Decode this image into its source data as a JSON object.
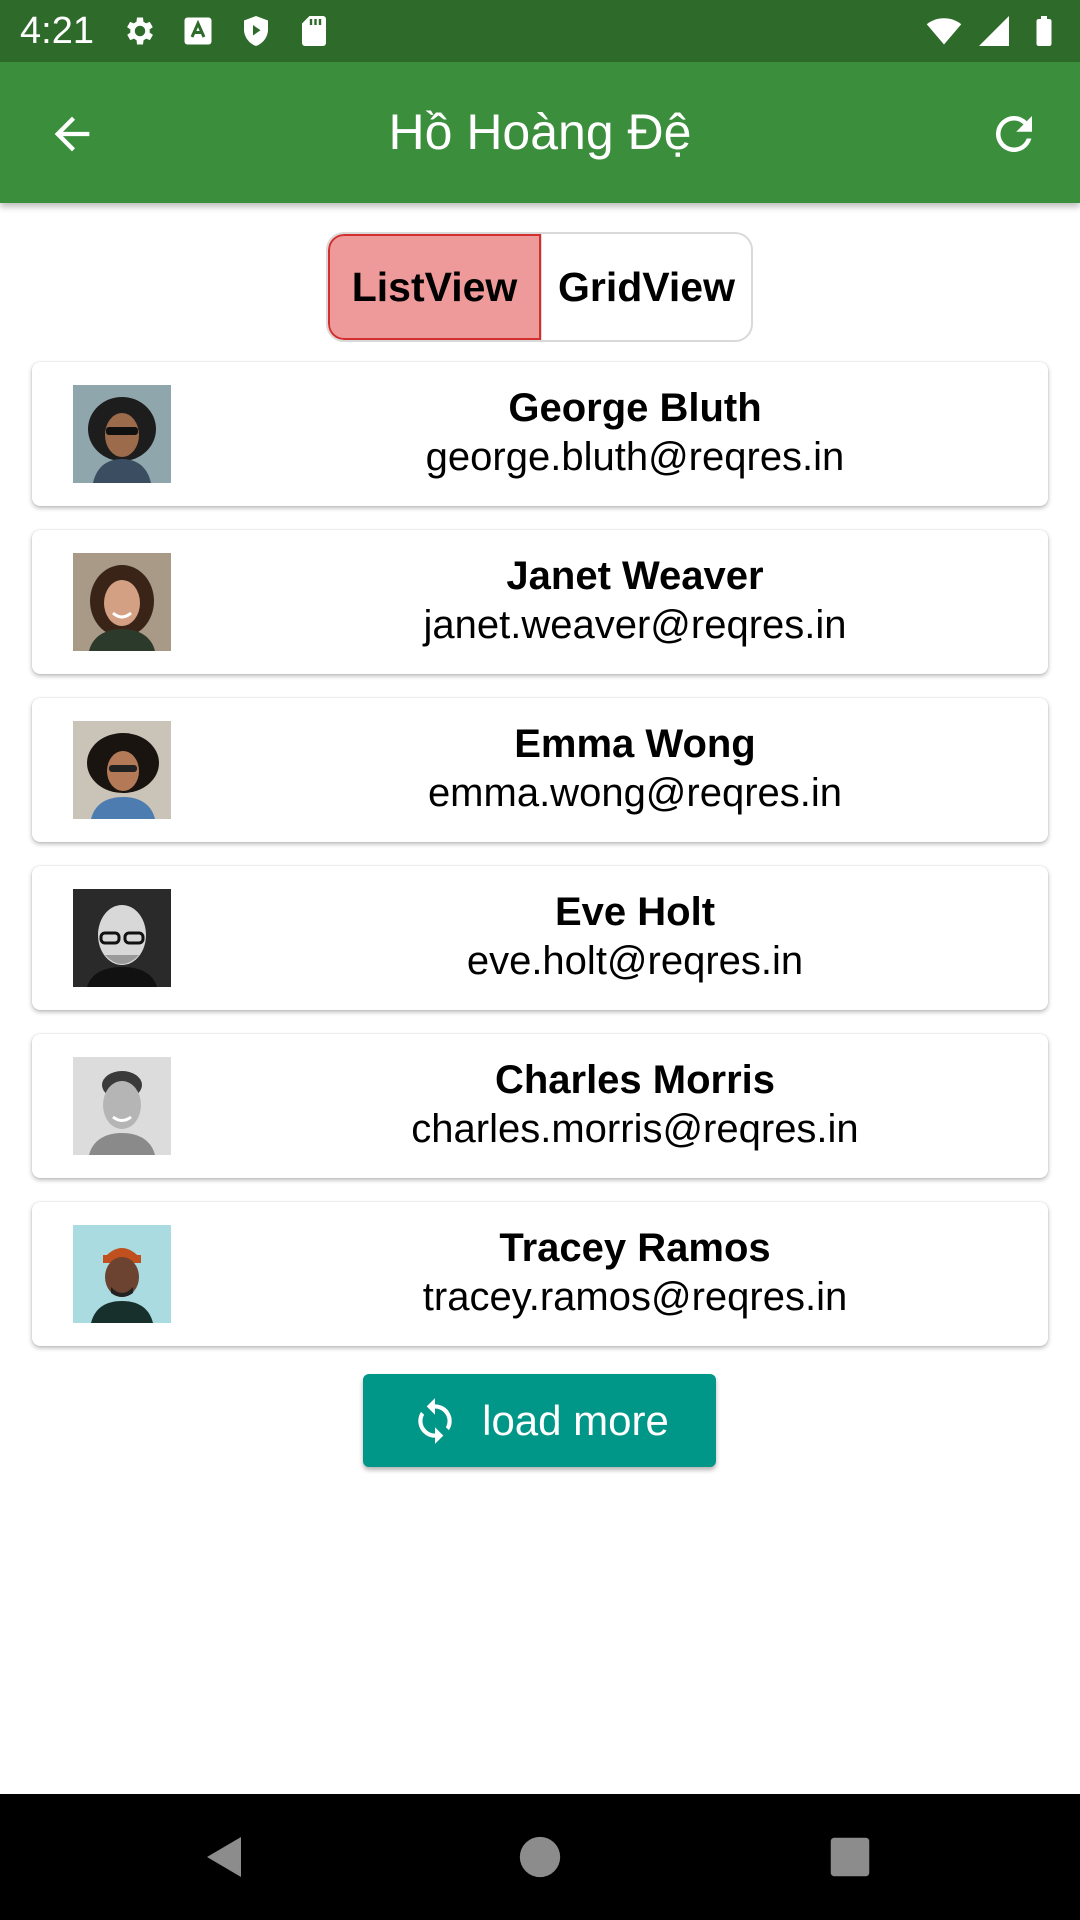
{
  "status_bar": {
    "time": "4:21",
    "left_icons": [
      "settings-icon",
      "a-badge-icon",
      "shield-play-icon",
      "sd-card-icon"
    ],
    "right_icons": [
      "wifi-icon",
      "signal-icon",
      "battery-icon"
    ]
  },
  "app_bar": {
    "title": "Hồ Hoàng Đệ",
    "back_icon": "arrow-back-icon",
    "refresh_icon": "refresh-icon",
    "color": "#3b8e3c"
  },
  "view_toggle": {
    "options": [
      {
        "label": "ListView",
        "selected": true
      },
      {
        "label": "GridView",
        "selected": false
      }
    ],
    "active_color": "#ef9a9a",
    "active_border": "#d32f2f"
  },
  "users": [
    {
      "name": "George Bluth",
      "email": "george.bluth@reqres.in"
    },
    {
      "name": "Janet Weaver",
      "email": "janet.weaver@reqres.in"
    },
    {
      "name": "Emma Wong",
      "email": "emma.wong@reqres.in"
    },
    {
      "name": "Eve Holt",
      "email": "eve.holt@reqres.in"
    },
    {
      "name": "Charles Morris",
      "email": "charles.morris@reqres.in"
    },
    {
      "name": "Tracey Ramos",
      "email": "tracey.ramos@reqres.in"
    }
  ],
  "load_more": {
    "label": "load more",
    "icon": "sync-icon",
    "color": "#009688"
  },
  "nav_bar": {
    "buttons": [
      "back-triangle-icon",
      "home-circle-icon",
      "recents-square-icon"
    ]
  }
}
